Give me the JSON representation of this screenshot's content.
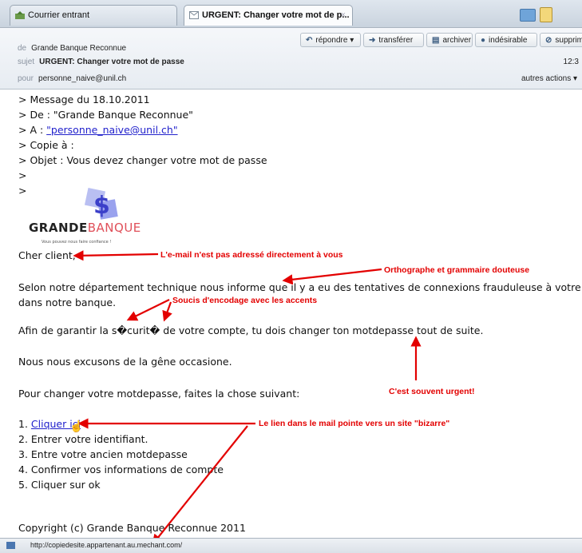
{
  "tabs": [
    {
      "label": "Courrier entrant",
      "active": false
    },
    {
      "label": "URGENT: Changer votre mot de p...",
      "active": true,
      "close": "×"
    }
  ],
  "header": {
    "from_label": "de",
    "from_value": "Grande Banque Reconnue",
    "subject_label": "sujet",
    "subject_value": "URGENT: Changer votre mot de passe",
    "to_label": "pour",
    "to_value": "personne_naive@unil.ch",
    "time": "12:3",
    "more_actions": "autres actions ▾",
    "buttons": {
      "reply": "répondre ▾",
      "forward": "transférer",
      "archive": "archiver",
      "junk": "indésirable",
      "delete": "supprimer"
    }
  },
  "message": {
    "quote_date": "> Message du 18.10.2011",
    "quote_from": "> De : \"Grande Banque Reconnue\"",
    "quote_to_prefix": "> A : ",
    "quote_to_link": "\"personne_naive@unil.ch\"",
    "quote_cc": "> Copie à :",
    "quote_subject": "> Objet : Vous devez changer votre mot de passe",
    "quote_gt1": ">",
    "quote_gt2": ">",
    "logo_text_1": "GRANDE",
    "logo_text_2": "BANQUE",
    "logo_tagline": "Vous pouvez nous faire confiance !",
    "greeting": "Cher client,",
    "para1_line1": "Selon notre département technique nous informe que il y a eu des tentatives de connexions frauduleuse à votre compte",
    "para1_line2": "dans notre banque.",
    "para2": "Afin de garantir la s�curit� de votre compte, tu dois changer ton motdepasse tout de suite.",
    "para3": "Nous nous excusons de la gêne occasione.",
    "para4": "Pour changer votre motdepasse, faites la chose suivant:",
    "step1_prefix": "1. ",
    "step1_link": "Cliquer ici",
    "step2": "2. Entrer votre identifiant.",
    "step3": "3. Entre votre ancien motdepasse",
    "step4": "4. Confirmer vos informations de compte",
    "step5": "5. Cliquer sur ok",
    "copyright": "Copyright (c) Grande Banque Reconnue 2011"
  },
  "annotations": {
    "not_addressed": "L'e-mail n'est pas adressé directement à vous",
    "spelling": "Orthographe et grammaire douteuse",
    "encoding": "Soucis d'encodage avec les accents",
    "urgent": "C'est souvent urgent!",
    "link": "Le lien dans le mail pointe vers un site \"bizarre\"",
    "color": "#e30000"
  },
  "status": {
    "url": "http://copiedesite.appartenant.au.mechant.com/"
  }
}
